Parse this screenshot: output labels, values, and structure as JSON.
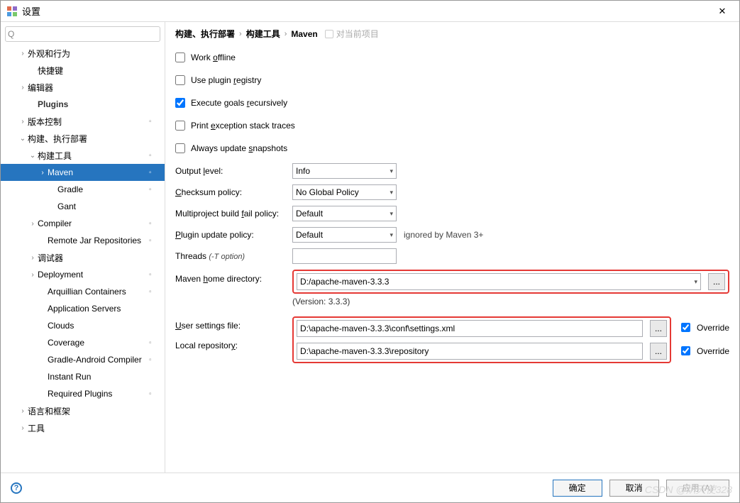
{
  "window": {
    "title": "设置",
    "close": "✕"
  },
  "search": {
    "placeholder": ""
  },
  "tree": [
    {
      "indent": 24,
      "arrow": "›",
      "label": "外观和行为"
    },
    {
      "indent": 38,
      "arrow": "",
      "label": "快捷键"
    },
    {
      "indent": 24,
      "arrow": "›",
      "label": "编辑器"
    },
    {
      "indent": 38,
      "arrow": "",
      "label": "Plugins",
      "bold": true
    },
    {
      "indent": 24,
      "arrow": "›",
      "label": "版本控制",
      "tag": true
    },
    {
      "indent": 24,
      "arrow": "⌄",
      "label": "构建、执行部署"
    },
    {
      "indent": 38,
      "arrow": "⌄",
      "label": "构建工具",
      "tag": true
    },
    {
      "indent": 52,
      "arrow": "›",
      "label": "Maven",
      "tag": true,
      "selected": true
    },
    {
      "indent": 66,
      "arrow": "",
      "label": "Gradle",
      "tag": true
    },
    {
      "indent": 66,
      "arrow": "",
      "label": "Gant"
    },
    {
      "indent": 38,
      "arrow": "›",
      "label": "Compiler",
      "tag": true
    },
    {
      "indent": 52,
      "arrow": "",
      "label": "Remote Jar Repositories",
      "tag": true
    },
    {
      "indent": 38,
      "arrow": "›",
      "label": "调试器"
    },
    {
      "indent": 38,
      "arrow": "›",
      "label": "Deployment",
      "tag": true
    },
    {
      "indent": 52,
      "arrow": "",
      "label": "Arquillian Containers",
      "tag": true
    },
    {
      "indent": 52,
      "arrow": "",
      "label": "Application Servers"
    },
    {
      "indent": 52,
      "arrow": "",
      "label": "Clouds"
    },
    {
      "indent": 52,
      "arrow": "",
      "label": "Coverage",
      "tag": true
    },
    {
      "indent": 52,
      "arrow": "",
      "label": "Gradle-Android Compiler",
      "tag": true
    },
    {
      "indent": 52,
      "arrow": "",
      "label": "Instant Run"
    },
    {
      "indent": 52,
      "arrow": "",
      "label": "Required Plugins",
      "tag": true
    },
    {
      "indent": 24,
      "arrow": "›",
      "label": "语言和框架"
    },
    {
      "indent": 24,
      "arrow": "›",
      "label": "工具"
    }
  ],
  "breadcrumb": {
    "c1": "构建、执行部署",
    "c2": "构建工具",
    "c3": "Maven",
    "scope": "对当前项目"
  },
  "cbs": {
    "offline": {
      "pre": "Work ",
      "u": "o",
      "post": "ffline",
      "checked": false
    },
    "plugin": {
      "pre": "Use plugin ",
      "u": "r",
      "post": "egistry",
      "checked": false
    },
    "exec": {
      "pre": "Execute goals ",
      "u": "r",
      "post": "ecursively",
      "checked": true
    },
    "print": {
      "pre": "Print ",
      "u": "e",
      "post": "xception stack traces",
      "checked": false
    },
    "always": {
      "pre": "Always update ",
      "u": "s",
      "post": "napshots",
      "checked": false
    }
  },
  "rows": {
    "output": {
      "label_pre": "Output ",
      "u": "l",
      "label_post": "evel:",
      "value": "Info"
    },
    "checksum": {
      "u": "C",
      "label_post": "hecksum policy:",
      "value": "No Global Policy"
    },
    "multi": {
      "label_pre": "Multiproject build ",
      "u": "f",
      "label_post": "ail policy:",
      "value": "Default"
    },
    "pluginupd": {
      "u": "P",
      "label_post": "lugin update policy:",
      "value": "Default",
      "note": "ignored by Maven 3+"
    },
    "threads": {
      "label": "Threads ",
      "opt": "(-T option)"
    },
    "home": {
      "label_pre": "Maven ",
      "u": "h",
      "label_post": "ome directory:",
      "value": "D:/apache-maven-3.3.3",
      "version": "(Version: 3.3.3)",
      "browse": "..."
    },
    "usersettings": {
      "u": "U",
      "label_post": "ser settings file:",
      "value": "D:\\apache-maven-3.3.3\\conf\\settings.xml",
      "browse": "...",
      "override": "Override"
    },
    "localrepo": {
      "label_pre": "Local repositor",
      "u": "y",
      "label_post": ":",
      "value": "D:\\apache-maven-3.3.3\\repository",
      "browse": "...",
      "override": "Override"
    }
  },
  "footer": {
    "ok": "确定",
    "cancel": "取消",
    "apply": "应用 (A)"
  },
  "watermark": "CSDN @炽天使328"
}
